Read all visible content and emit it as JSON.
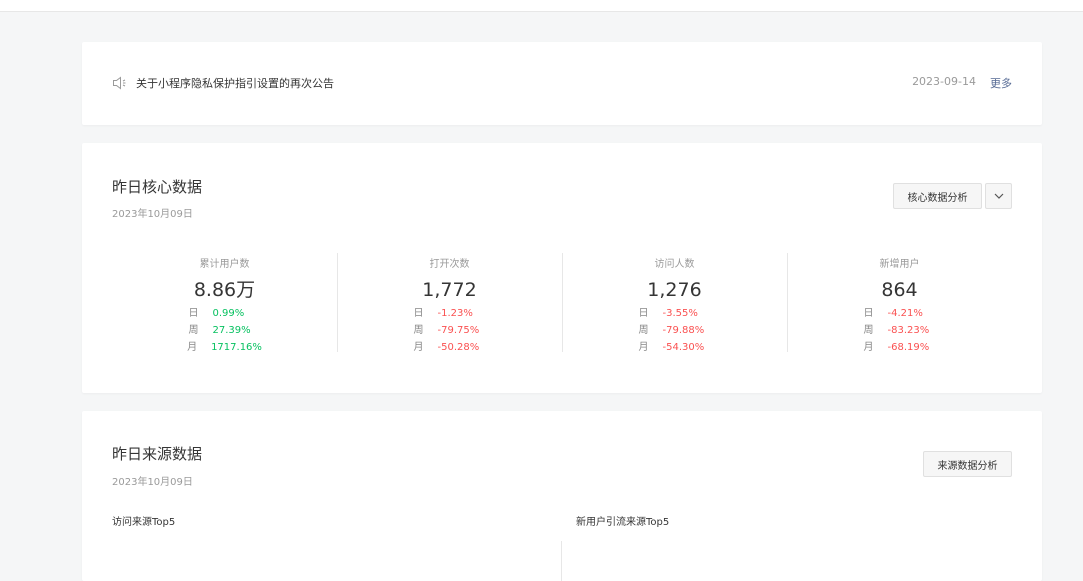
{
  "notice": {
    "text": "关于小程序隐私保护指引设置的再次公告",
    "date": "2023-09-14",
    "more": "更多"
  },
  "core": {
    "title": "昨日核心数据",
    "date": "2023年10月09日",
    "analysis_button": "核心数据分析",
    "metrics": [
      {
        "label": "累计用户数",
        "value": "8.86万",
        "rows": [
          {
            "period": "日",
            "change": "0.99%",
            "trend": "up"
          },
          {
            "period": "周",
            "change": "27.39%",
            "trend": "up"
          },
          {
            "period": "月",
            "change": "1717.16%",
            "trend": "up"
          }
        ]
      },
      {
        "label": "打开次数",
        "value": "1,772",
        "rows": [
          {
            "period": "日",
            "change": "-1.23%",
            "trend": "down"
          },
          {
            "period": "周",
            "change": "-79.75%",
            "trend": "down"
          },
          {
            "period": "月",
            "change": "-50.28%",
            "trend": "down"
          }
        ]
      },
      {
        "label": "访问人数",
        "value": "1,276",
        "rows": [
          {
            "period": "日",
            "change": "-3.55%",
            "trend": "down"
          },
          {
            "period": "周",
            "change": "-79.88%",
            "trend": "down"
          },
          {
            "period": "月",
            "change": "-54.30%",
            "trend": "down"
          }
        ]
      },
      {
        "label": "新增用户",
        "value": "864",
        "rows": [
          {
            "period": "日",
            "change": "-4.21%",
            "trend": "down"
          },
          {
            "period": "周",
            "change": "-83.23%",
            "trend": "down"
          },
          {
            "period": "月",
            "change": "-68.19%",
            "trend": "down"
          }
        ]
      }
    ]
  },
  "source": {
    "title": "昨日来源数据",
    "date": "2023年10月09日",
    "analysis_button": "来源数据分析",
    "visit_top5": "访问来源Top5",
    "newuser_top5": "新用户引流来源Top5"
  },
  "colors": {
    "up": "#07c160",
    "down": "#fa5151",
    "link": "#576b95"
  },
  "icons": {
    "notice": "speaker-icon",
    "dropdown": "chevron-down-icon"
  }
}
